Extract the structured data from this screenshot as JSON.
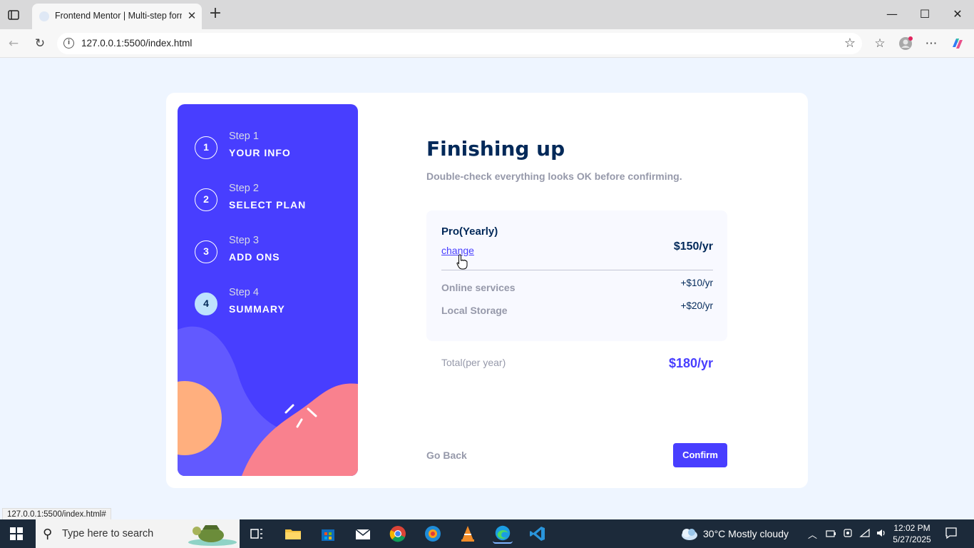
{
  "browser": {
    "tab_title": "Frontend Mentor | Multi-step form",
    "url": "127.0.0.1:5500/index.html",
    "status_url": "127.0.0.1:5500/index.html#"
  },
  "sidebar": {
    "steps": [
      {
        "num": "1",
        "small": "Step 1",
        "big": "YOUR INFO"
      },
      {
        "num": "2",
        "small": "Step 2",
        "big": "SELECT PLAN"
      },
      {
        "num": "3",
        "small": "Step 3",
        "big": "ADD ONS"
      },
      {
        "num": "4",
        "small": "Step 4",
        "big": "SUMMARY"
      }
    ]
  },
  "main": {
    "title": "Finishing up",
    "subtitle": "Double-check everything looks OK before confirming.",
    "plan": {
      "name": "Pro(Yearly)",
      "change": "change",
      "price": "$150/yr"
    },
    "addons": [
      {
        "name": "Online services",
        "price": "+$10/yr"
      },
      {
        "name": "Local Storage",
        "price": "+$20/yr"
      }
    ],
    "total": {
      "label": "Total(per year)",
      "price": "$180/yr"
    },
    "go_back": "Go Back",
    "confirm": "Confirm"
  },
  "taskbar": {
    "search_placeholder": "Type here to search",
    "weather": "30°C  Mostly cloudy",
    "time": "12:02 PM",
    "date": "5/27/2025"
  },
  "colors": {
    "accent": "#483eff",
    "marine": "#022959",
    "grey": "#9699aa",
    "page_bg": "#eef5ff"
  }
}
